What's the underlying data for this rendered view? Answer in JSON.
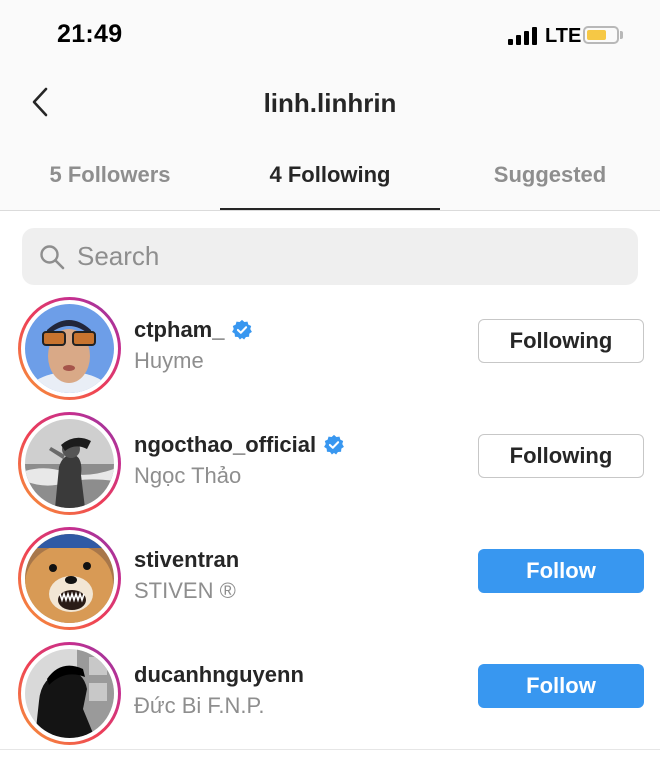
{
  "status_bar": {
    "time": "21:49",
    "network": "LTE"
  },
  "nav": {
    "title": "linh.linhrin"
  },
  "tabs": [
    {
      "label": "5 Followers",
      "active": false
    },
    {
      "label": "4 Following",
      "active": true
    },
    {
      "label": "Suggested",
      "active": false
    }
  ],
  "search": {
    "placeholder": "Search",
    "value": ""
  },
  "users": [
    {
      "username": "ctpham_",
      "name": "Huyme",
      "verified": true,
      "button": "Following"
    },
    {
      "username": "ngocthao_official",
      "name": "Ngọc Thảo",
      "verified": true,
      "button": "Following"
    },
    {
      "username": "stiventran",
      "name": "STIVEN ®",
      "verified": false,
      "button": "Follow"
    },
    {
      "username": "ducanhnguyenn",
      "name": "Đức Bi F.N.P.",
      "verified": false,
      "button": "Follow"
    }
  ],
  "colors": {
    "follow_button": "#3897f0",
    "verified_badge": "#3897f0",
    "battery": "#f6c845"
  }
}
